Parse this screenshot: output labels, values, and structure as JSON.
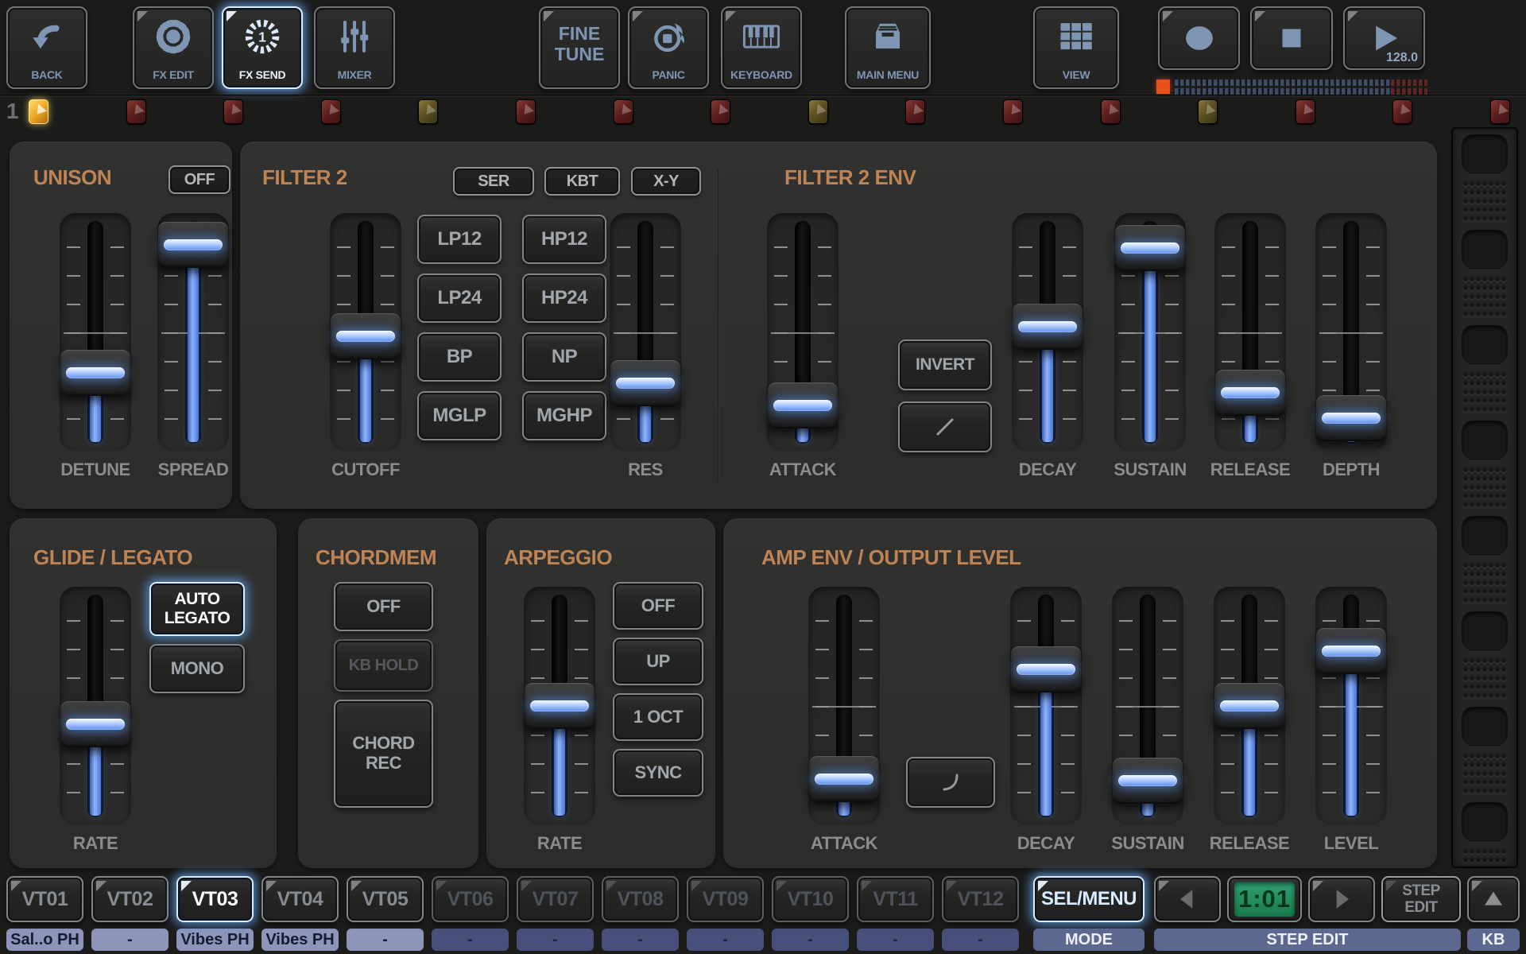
{
  "toolbar": {
    "back": "BACK",
    "fx_edit": "FX EDIT",
    "fx_send": "FX SEND",
    "fx_send_number": "1",
    "mixer": "MIXER",
    "fine_tune": "FINE TUNE",
    "panic": "PANIC",
    "keyboard": "KEYBOARD",
    "main_menu": "MAIN MENU",
    "view": "VIEW",
    "bpm": "128.0"
  },
  "track_row": {
    "number": "1",
    "leds": [
      "selected",
      "red",
      "red",
      "red",
      "olive",
      "red",
      "red",
      "red",
      "olive",
      "red",
      "red",
      "red",
      "olive",
      "red",
      "red",
      "red"
    ]
  },
  "panels": {
    "unison": {
      "title": "UNISON",
      "off_button": "OFF",
      "sliders": [
        {
          "label": "DETUNE",
          "pos": 72
        },
        {
          "label": "SPREAD",
          "pos": 2
        }
      ]
    },
    "filter2": {
      "title": "FILTER 2",
      "mode_buttons": [
        "SER",
        "KBT",
        "X-Y"
      ],
      "type_buttons": [
        "LP12",
        "HP12",
        "LP24",
        "HP24",
        "BP",
        "NP",
        "MGLP",
        "MGHP"
      ],
      "sliders": [
        {
          "label": "CUTOFF",
          "pos": 52
        },
        {
          "label": "RES",
          "pos": 78
        }
      ]
    },
    "filter2_env": {
      "title": "FILTER 2 ENV",
      "invert_button": "INVERT",
      "sliders": [
        {
          "label": "ATTACK",
          "pos": 90
        },
        {
          "label": "DECAY",
          "pos": 47
        },
        {
          "label": "SUSTAIN",
          "pos": 4
        },
        {
          "label": "RELEASE",
          "pos": 83
        },
        {
          "label": "DEPTH",
          "pos": 97
        }
      ]
    },
    "glide_legato": {
      "title": "GLIDE / LEGATO",
      "auto_legato_button": "AUTO LEGATO",
      "mono_button": "MONO",
      "sliders": [
        {
          "label": "RATE",
          "pos": 60
        }
      ]
    },
    "chordmem": {
      "title": "CHORDMEM",
      "off_button": "OFF",
      "kb_hold_button": "KB HOLD",
      "chord_rec_button": "CHORD REC"
    },
    "arpeggio": {
      "title": "ARPEGGIO",
      "buttons": [
        "OFF",
        "UP",
        "1 OCT",
        "SYNC"
      ],
      "sliders": [
        {
          "label": "RATE",
          "pos": 50
        }
      ]
    },
    "amp_env": {
      "title": "AMP ENV / OUTPUT LEVEL",
      "sliders": [
        {
          "label": "ATTACK",
          "pos": 90
        },
        {
          "label": "DECAY",
          "pos": 30
        },
        {
          "label": "SUSTAIN",
          "pos": 91
        },
        {
          "label": "RELEASE",
          "pos": 50
        },
        {
          "label": "LEVEL",
          "pos": 20
        }
      ]
    }
  },
  "bottom_bar": {
    "tracks": [
      {
        "id": "VT01",
        "label": "Sal..o PH",
        "state": "on"
      },
      {
        "id": "VT02",
        "label": "-",
        "state": "on"
      },
      {
        "id": "VT03",
        "label": "Vibes PH",
        "state": "selected"
      },
      {
        "id": "VT04",
        "label": "Vibes PH",
        "state": "on"
      },
      {
        "id": "VT05",
        "label": "-",
        "state": "on"
      },
      {
        "id": "VT06",
        "label": "-",
        "state": "off"
      },
      {
        "id": "VT07",
        "label": "-",
        "state": "off"
      },
      {
        "id": "VT08",
        "label": "-",
        "state": "off"
      },
      {
        "id": "VT09",
        "label": "-",
        "state": "off"
      },
      {
        "id": "VT10",
        "label": "-",
        "state": "off"
      },
      {
        "id": "VT11",
        "label": "-",
        "state": "off"
      },
      {
        "id": "VT12",
        "label": "-",
        "state": "off"
      }
    ],
    "sel_menu_button": "SEL/MENU",
    "mode_label": "MODE",
    "position_display": "1:01",
    "step_edit_button": "STEP EDIT",
    "step_edit_label": "STEP EDIT",
    "kb_label": "KB"
  },
  "colors": {
    "accent": "#7fb2e8",
    "section_title": "#bf8455",
    "lcd_green": "#1f8a60",
    "meter_orange": "#e8501e",
    "fader_blue": "#6b96e8",
    "selected_led": "#f0b840"
  }
}
